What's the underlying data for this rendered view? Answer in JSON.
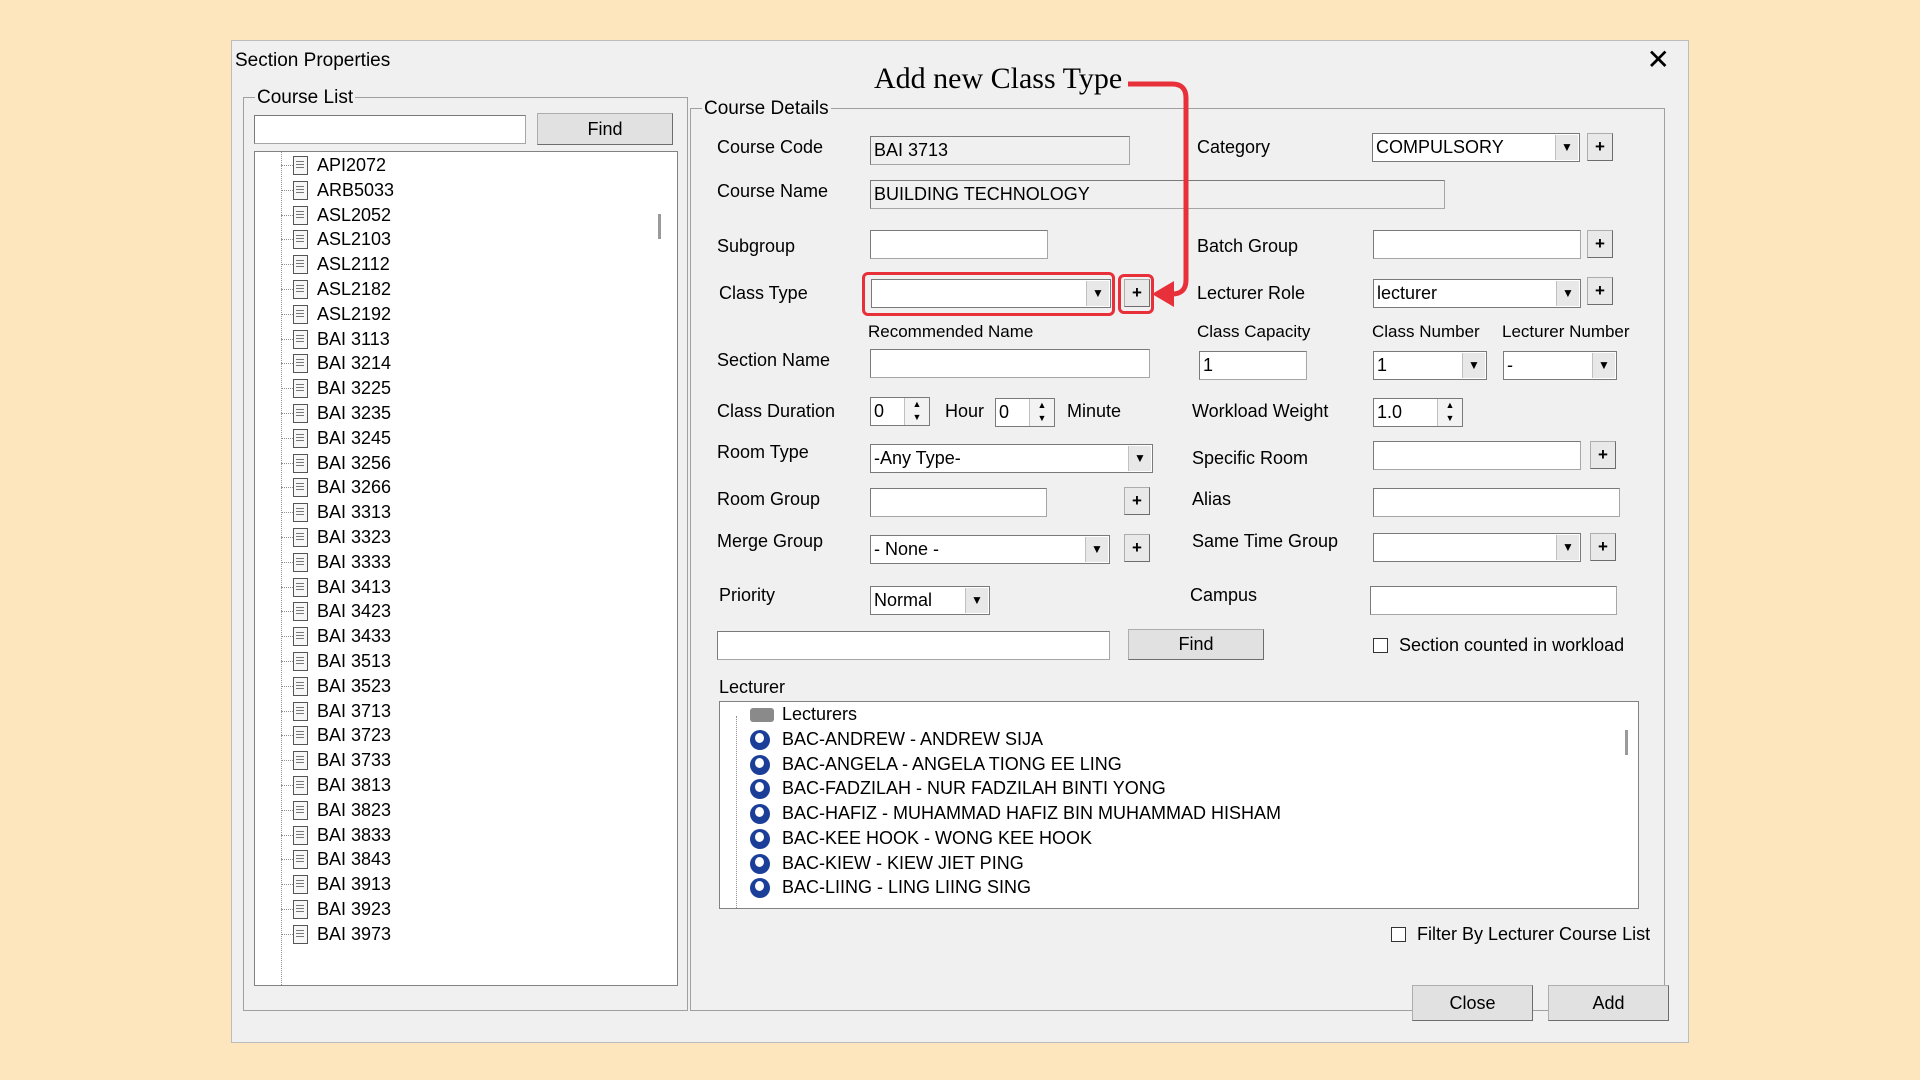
{
  "window": {
    "title": "Section Properties",
    "close_glyph": "✕"
  },
  "annotation": {
    "text": "Add new Class Type",
    "color": "#e8303a"
  },
  "course_list": {
    "legend": "Course List",
    "search_value": "",
    "find_label": "Find",
    "items": [
      "API2072",
      "ARB5033",
      "ASL2052",
      "ASL2103",
      "ASL2112",
      "ASL2182",
      "ASL2192",
      "BAI 3113",
      "BAI 3214",
      "BAI 3225",
      "BAI 3235",
      "BAI 3245",
      "BAI 3256",
      "BAI 3266",
      "BAI 3313",
      "BAI 3323",
      "BAI 3333",
      "BAI 3413",
      "BAI 3423",
      "BAI 3433",
      "BAI 3513",
      "BAI 3523",
      "BAI 3713",
      "BAI 3723",
      "BAI 3733",
      "BAI 3813",
      "BAI 3823",
      "BAI 3833",
      "BAI 3843",
      "BAI 3913",
      "BAI 3923",
      "BAI 3973"
    ]
  },
  "details": {
    "legend": "Course Details",
    "course_code_label": "Course Code",
    "course_code": "BAI 3713",
    "course_name_label": "Course Name",
    "course_name": "BUILDING TECHNOLOGY",
    "category_label": "Category",
    "category": "COMPULSORY",
    "subgroup_label": "Subgroup",
    "subgroup": "",
    "batch_group_label": "Batch Group",
    "batch_group": "",
    "class_type_label": "Class Type",
    "class_type": "",
    "lecturer_role_label": "Lecturer Role",
    "lecturer_role": "lecturer",
    "recommended_name_label": "Recommended Name",
    "section_name_label": "Section Name",
    "section_name": "",
    "class_capacity_label": "Class Capacity",
    "class_capacity": "1",
    "class_number_label": "Class Number",
    "class_number": "1",
    "lecturer_number_label": "Lecturer Number",
    "lecturer_number": "-",
    "class_duration_label": "Class Duration",
    "duration_hour": "0",
    "hour_label": "Hour",
    "duration_minute": "0",
    "minute_label": "Minute",
    "workload_weight_label": "Workload Weight",
    "workload_weight": "1.0",
    "room_type_label": "Room Type",
    "room_type": "-Any Type-",
    "specific_room_label": "Specific Room",
    "specific_room": "",
    "room_group_label": "Room Group",
    "room_group": "",
    "alias_label": "Alias",
    "alias": "",
    "merge_group_label": "Merge Group",
    "merge_group": "- None -",
    "same_time_group_label": "Same Time Group",
    "same_time_group": "",
    "priority_label": "Priority",
    "priority": "Normal",
    "campus_label": "Campus",
    "campus": "",
    "lecturer_search": "",
    "find_label": "Find",
    "workload_checkbox_label": "Section counted in workload",
    "workload_checked": false,
    "plus_glyph": "+"
  },
  "lecturer": {
    "label": "Lecturer",
    "root": "Lecturers",
    "items": [
      "BAC-ANDREW - ANDREW SIJA",
      "BAC-ANGELA - ANGELA TIONG EE LING",
      "BAC-FADZILAH - NUR FADZILAH BINTI YONG",
      "BAC-HAFIZ - MUHAMMAD HAFIZ BIN MUHAMMAD HISHAM",
      "BAC-KEE HOOK - WONG KEE HOOK",
      "BAC-KIEW - KIEW JIET PING",
      "BAC-LIING - LING LIING SING"
    ],
    "filter_label": "Filter By Lecturer Course List",
    "filter_checked": false
  },
  "footer": {
    "close_label": "Close",
    "add_label": "Add"
  }
}
